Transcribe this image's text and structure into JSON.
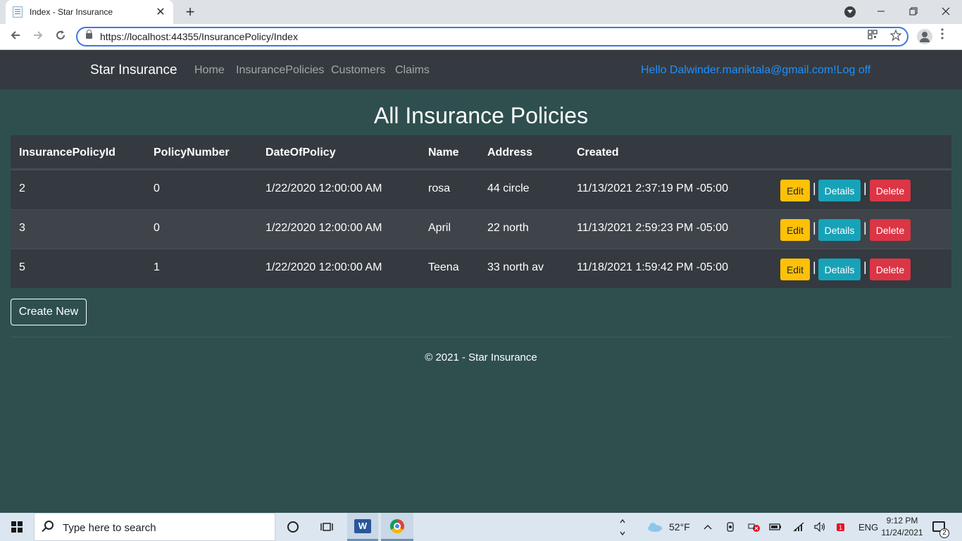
{
  "browser": {
    "tab_title": "Index - Star Insurance",
    "tab_close": "✕",
    "new_tab": "+",
    "url": "https://localhost:44355/InsurancePolicy/Index"
  },
  "navbar": {
    "brand": "Star Insurance",
    "links": [
      "Home",
      "InsurancePolicies",
      "Customers",
      "Claims"
    ],
    "greeting": "Hello Dalwinder.maniktala@gmail.com!",
    "logout": "Log off"
  },
  "page": {
    "title": "All Insurance Policies",
    "columns": [
      "InsurancePolicyId",
      "PolicyNumber",
      "DateOfPolicy",
      "Name",
      "Address",
      "Created"
    ],
    "rows": [
      {
        "id": "2",
        "policy_number": "0",
        "date": "1/22/2020 12:00:00 AM",
        "name": "rosa",
        "address": "44 circle",
        "created": "11/13/2021 2:37:19 PM -05:00"
      },
      {
        "id": "3",
        "policy_number": "0",
        "date": "1/22/2020 12:00:00 AM",
        "name": "April",
        "address": "22 north",
        "created": "11/13/2021 2:59:23 PM -05:00"
      },
      {
        "id": "5",
        "policy_number": "1",
        "date": "1/22/2020 12:00:00 AM",
        "name": "Teena",
        "address": "33 north av",
        "created": "11/18/2021 1:59:42 PM -05:00"
      }
    ],
    "actions": {
      "edit": "Edit",
      "details": "Details",
      "delete": "Delete",
      "separator": "|"
    },
    "create_new": "Create New",
    "footer": "© 2021 - Star Insurance"
  },
  "taskbar": {
    "search_placeholder": "Type here to search",
    "word_label": "W",
    "weather": "52°F",
    "language": "ENG",
    "time": "9:12 PM",
    "date": "11/24/2021",
    "notification_count": "2"
  },
  "colors": {
    "page_bg": "#2f4f4f",
    "navbar_bg": "#343a40",
    "table_bg": "#343a40",
    "edit": "#ffc107",
    "details": "#17a2b8",
    "delete": "#dc3545",
    "link": "#1e90ff"
  }
}
